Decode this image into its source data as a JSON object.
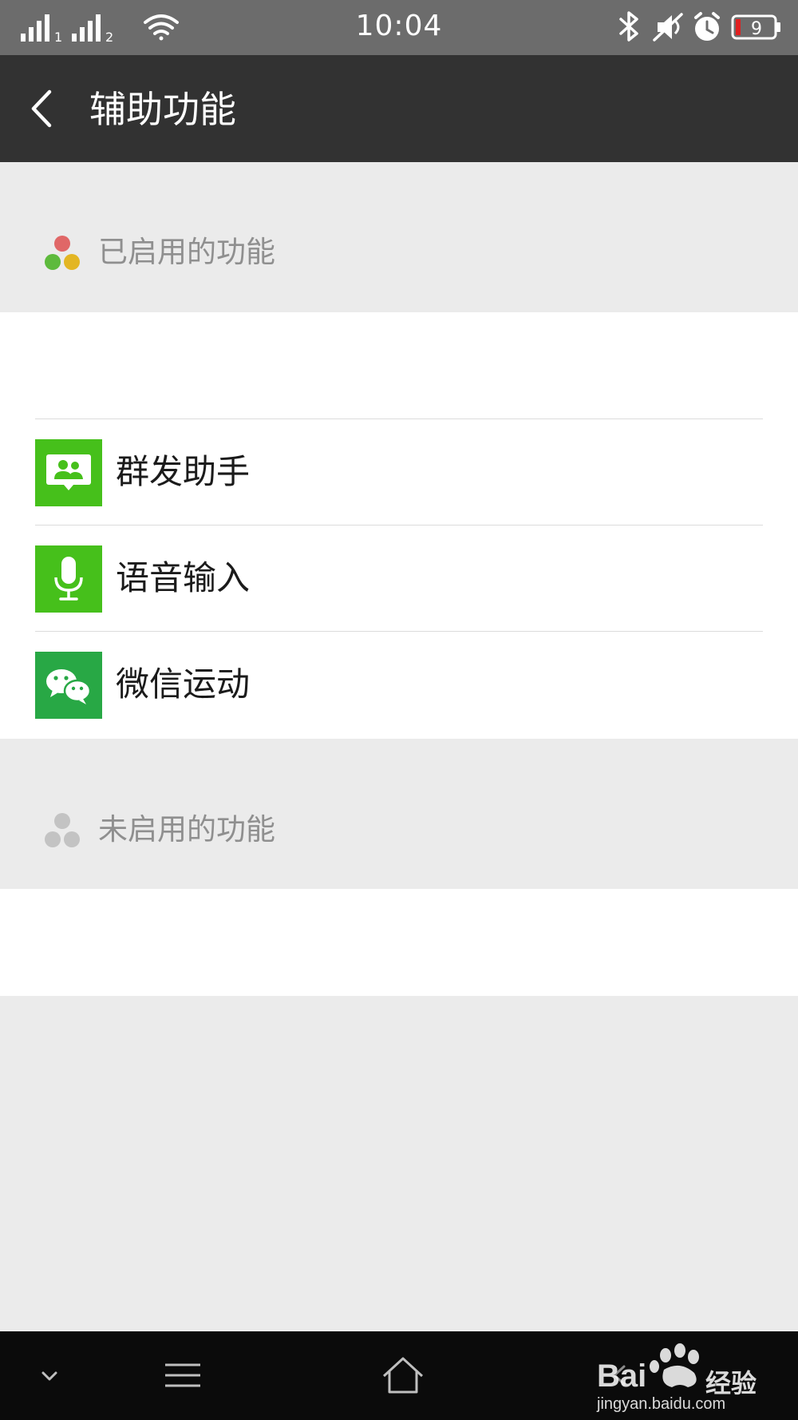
{
  "status_bar": {
    "time": "10:04",
    "battery_level": "9",
    "sim1_label": "1",
    "sim2_label": "2",
    "icons": [
      "signal-icon",
      "wifi-icon",
      "bluetooth-icon",
      "mute-icon",
      "alarm-icon",
      "battery-icon"
    ]
  },
  "header": {
    "title": "辅助功能",
    "back_icon": "chevron-left-icon"
  },
  "enabled_section": {
    "label": "已启用的功能",
    "items": [
      {
        "label": "群发助手",
        "icon": "broadcast-helper-icon",
        "color": "#46c01b"
      },
      {
        "label": "语音输入",
        "icon": "microphone-icon",
        "color": "#46c01b"
      },
      {
        "label": "微信运动",
        "icon": "wechat-icon",
        "color": "#28a845"
      }
    ]
  },
  "disabled_section": {
    "label": "未启用的功能",
    "items": []
  },
  "nav_bar": {
    "buttons": [
      "chevron-down-icon",
      "menu-icon",
      "home-icon",
      "back-icon"
    ]
  },
  "watermark": {
    "brand": "Bai",
    "brand_suffix": "经验",
    "url": "jingyan.baidu.com"
  },
  "colors": {
    "status_bar": "#6c6c6c",
    "title_bar": "#323232",
    "page_bg": "#ebebeb",
    "accent_green": "#46c01b",
    "dot_red": "#e06767",
    "dot_green": "#5dba3c",
    "dot_yellow": "#e3b623",
    "dot_gray": "#c3c3c3"
  }
}
